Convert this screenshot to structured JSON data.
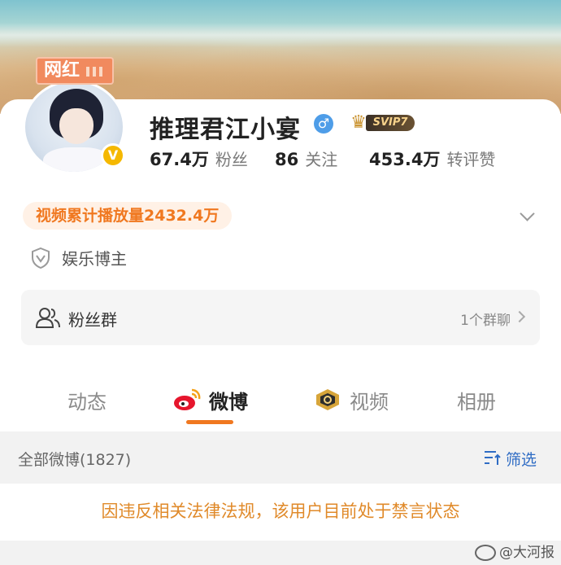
{
  "badge": {
    "wanghong": "网红"
  },
  "profile": {
    "name": "推理君江小宴",
    "gender_symbol": "♂",
    "verified_symbol": "V",
    "vip_label": "SVIP7",
    "vip_crown": "♛"
  },
  "stats": {
    "fans": {
      "value": "67.4万",
      "label": "粉丝"
    },
    "following": {
      "value": "86",
      "label": "关注"
    },
    "interactions": {
      "value": "453.4万",
      "label": "转评赞"
    }
  },
  "video_views": "视频累计播放量2432.4万",
  "category": "娱乐博主",
  "fan_group": {
    "label": "粉丝群",
    "count": "1个群聊"
  },
  "tabs": [
    {
      "label": "动态",
      "icon": ""
    },
    {
      "label": "微博",
      "icon": "weibo-logo-icon"
    },
    {
      "label": "视频",
      "icon": "video-badge-icon"
    },
    {
      "label": "相册",
      "icon": ""
    }
  ],
  "filter_bar": {
    "all_posts": "全部微博(1827)",
    "filter_label": "筛选"
  },
  "banned_notice": "因违反相关法律法规，该用户目前处于禁言状态",
  "watermark": "@大河报",
  "colors": {
    "accent_orange": "#f07820",
    "link_blue": "#2f6cc4",
    "notice_orange": "#e08a2a",
    "pill_bg": "#fff1e6"
  }
}
